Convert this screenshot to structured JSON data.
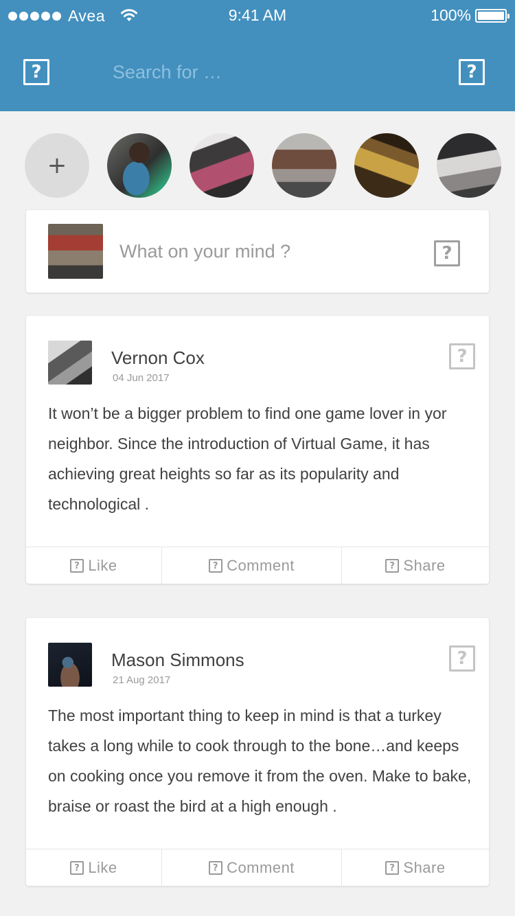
{
  "status_bar": {
    "carrier": "Avea",
    "time": "9:41 AM",
    "battery": "100%"
  },
  "header": {
    "left_icon": "unknown-icon",
    "right_icon": "unknown-icon",
    "search_placeholder": "Search for …",
    "background_color": "#4390be"
  },
  "stories": {
    "add_label": "+",
    "items": [
      "story-chef",
      "story-street",
      "story-cars",
      "story-taxi",
      "story-street-night"
    ]
  },
  "composer": {
    "placeholder": "What on your mind ?",
    "icon": "unknown-icon"
  },
  "posts": [
    {
      "author": "Vernon Cox",
      "date": "04 Jun 2017",
      "text": "It won’t be a bigger problem to find one game lover in yor neighbor. Since the introduction of Virtual Game, it has achieving great heights so far as its popularity and technological .",
      "actions": {
        "like": "Like",
        "comment": "Comment",
        "share": "Share"
      }
    },
    {
      "author": "Mason Simmons",
      "date": "21 Aug 2017",
      "text": "The most important thing to keep in mind is that a turkey takes a long while to cook through to the bone…and keeps on cooking once you remove it from the oven. Make to bake, braise or roast the bird at a high enough .",
      "actions": {
        "like": "Like",
        "comment": "Comment",
        "share": "Share"
      }
    }
  ]
}
